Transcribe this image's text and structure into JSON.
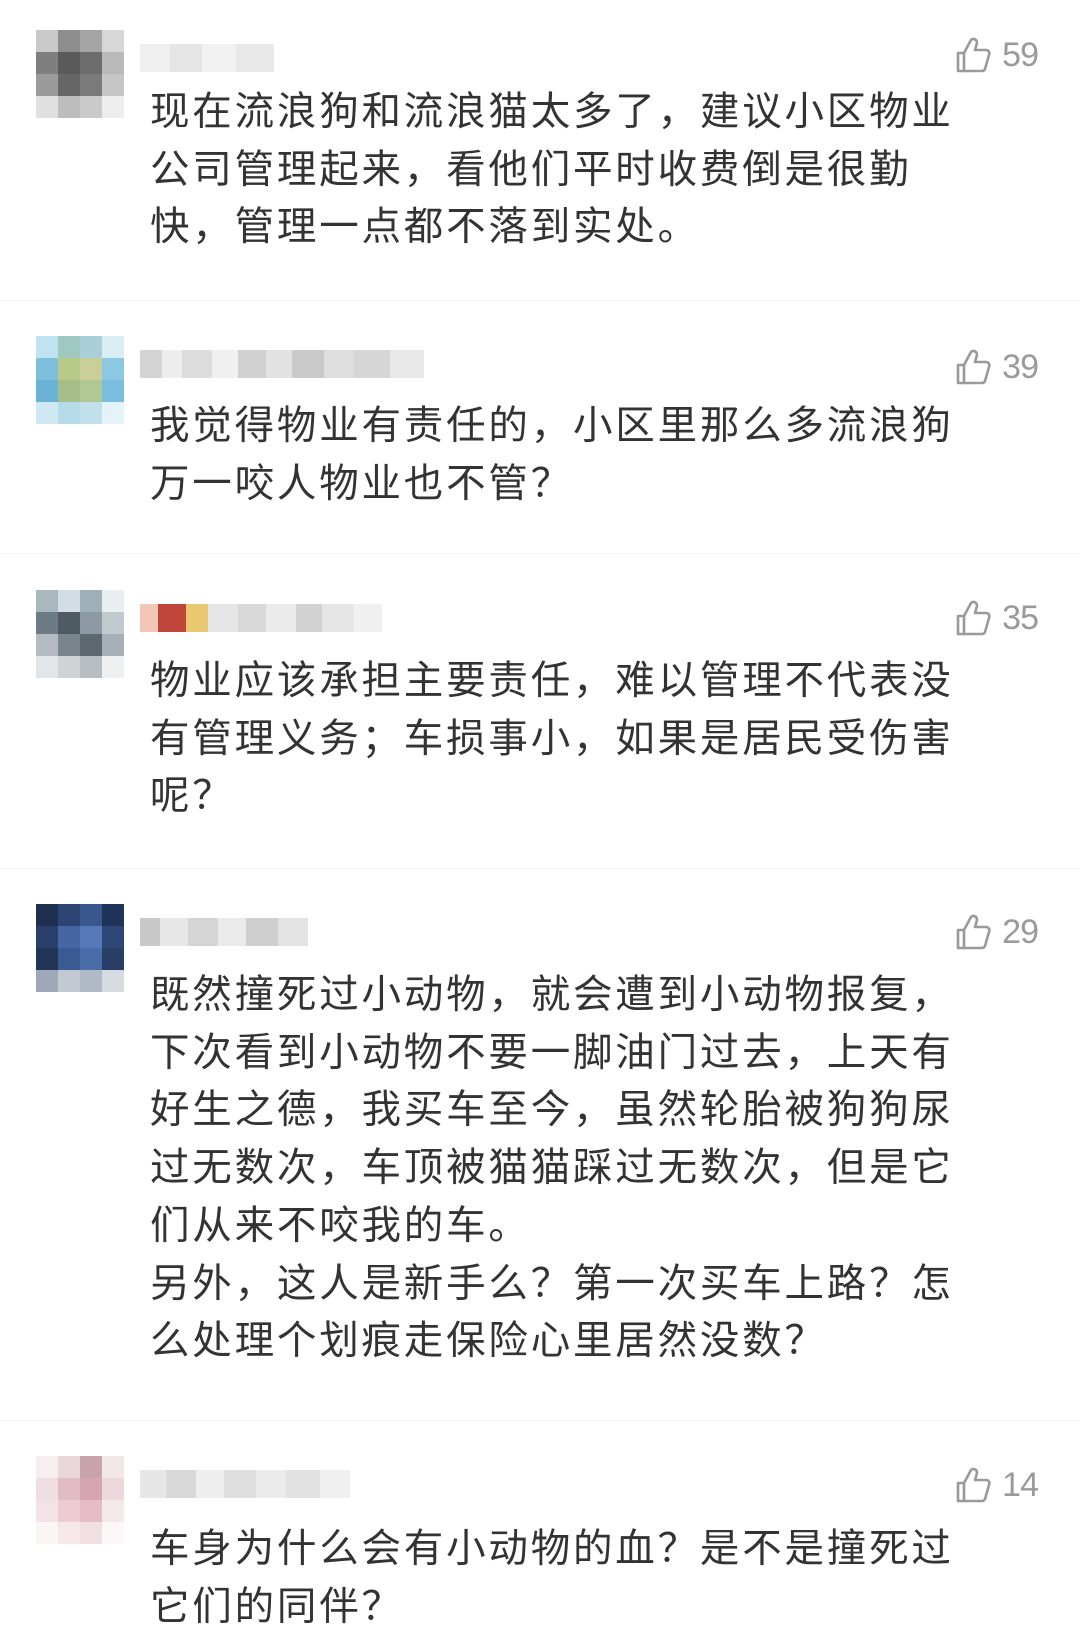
{
  "comments": [
    {
      "likes": "59",
      "text": "现在流浪狗和流浪猫太多了，建议小区物业\n公司管理起来，看他们平时收费倒是很勤\n快，管理一点都不落到实处。"
    },
    {
      "likes": "39",
      "text": "我觉得物业有责任的，小区里那么多流浪狗\n万一咬人物业也不管？"
    },
    {
      "likes": "35",
      "text": "物业应该承担主要责任，难以管理不代表没\n有管理义务；车损事小，如果是居民受伤害\n呢？"
    },
    {
      "likes": "29",
      "text": "既然撞死过小动物，就会遭到小动物报复，\n下次看到小动物不要一脚油门过去，上天有\n好生之德，我买车至今，虽然轮胎被狗狗尿\n过无数次，车顶被猫猫踩过无数次，但是它\n们从来不咬我的车。\n另外，这人是新手么？第一次买车上路？怎\n么处理个划痕走保险心里居然没数？"
    },
    {
      "likes": "14",
      "text": "车身为什么会有小动物的血？是不是撞死过\n它们的同伴？"
    }
  ],
  "icons": {
    "like": "thumbs-up-icon",
    "avatar": "blurred-avatar-image",
    "username": "blurred-username-text"
  },
  "colors": {
    "text": "#333333",
    "like_count": "#9a9a9a",
    "background": "#ffffff"
  }
}
